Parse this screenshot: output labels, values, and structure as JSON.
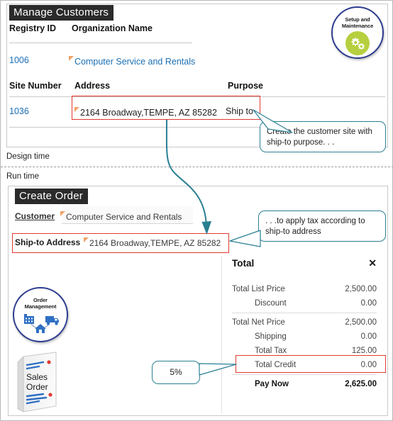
{
  "design": {
    "phase_label": "Design time",
    "window_title": "Manage Customers",
    "customer_table": {
      "headers": [
        "Registry ID",
        "Organization Name"
      ],
      "rows": [
        {
          "registry_id": "1006",
          "organization_name": "Computer Service and Rentals"
        }
      ]
    },
    "site_table": {
      "headers": [
        "Site Number",
        "Address",
        "Purpose"
      ],
      "rows": [
        {
          "site_number": "1036",
          "address": "2164 Broadway,TEMPE, AZ 85282",
          "purpose": "Ship to"
        }
      ]
    },
    "setup_badge": {
      "line1": "Setup and",
      "line2": "Maintenance",
      "icon": "gears-icon",
      "ring_color": "#2d3c8f",
      "disc_color": "#b5cf3f"
    },
    "callout": "Create the customer site with ship-to purpose. . ."
  },
  "runtime": {
    "phase_label": "Run time",
    "window_title": "Create Order",
    "customer_field": {
      "label": "Customer",
      "value": "Computer Service and Rentals"
    },
    "ship_to_field": {
      "label": "Ship-to Address",
      "value": "2164 Broadway,TEMPE, AZ 85282"
    },
    "callout_tax": ". . .to apply tax according to ship-to address",
    "callout_rate": "5%",
    "order_badge": {
      "line1": "Order",
      "line2": "Management",
      "icon": "supply-chain-icon",
      "ring_color": "#2d3c8f"
    },
    "sales_order_doc": {
      "line1": "Sales",
      "line2": "Order",
      "icon": "document-icon"
    },
    "totals": {
      "title": "Total",
      "close_icon": "close-icon",
      "rows": [
        {
          "label": "Total List Price",
          "value": "2,500.00",
          "indent": false,
          "bold": false,
          "highlight": false
        },
        {
          "label": "Discount",
          "value": "0.00",
          "indent": true,
          "bold": false,
          "highlight": false
        },
        {
          "separator": true
        },
        {
          "label": "Total Net Price",
          "value": "2,500.00",
          "indent": false,
          "bold": false,
          "highlight": false
        },
        {
          "label": "Shipping",
          "value": "0.00",
          "indent": true,
          "bold": false,
          "highlight": false
        },
        {
          "label": "Total Tax",
          "value": "125.00",
          "indent": true,
          "bold": false,
          "highlight": true
        },
        {
          "label": "Total Credit",
          "value": "0.00",
          "indent": true,
          "bold": false,
          "highlight": false
        },
        {
          "separator": true
        },
        {
          "label": "Pay Now",
          "value": "2,625.00",
          "indent": true,
          "bold": true,
          "highlight": false
        }
      ]
    }
  },
  "colors": {
    "highlight_red": "#e03a32",
    "callout_teal": "#2a7f93",
    "link_blue": "#1a6fb5",
    "required_orange": "#f0a26a"
  }
}
